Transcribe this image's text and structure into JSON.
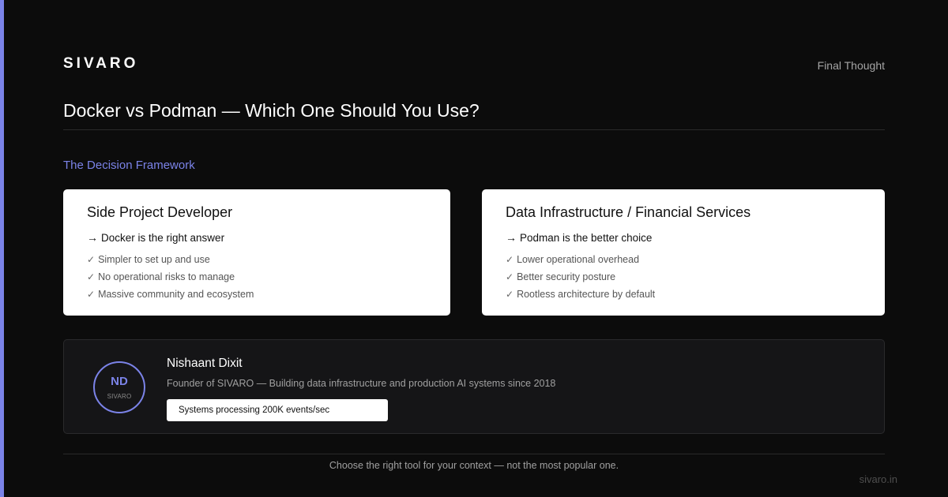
{
  "header": {
    "brand": "SIVARO",
    "tag": "Final Thought",
    "title": "Docker vs Podman — Which One Should You Use?"
  },
  "section": {
    "label": "The Decision Framework"
  },
  "cards": [
    {
      "title": "Side Project Developer",
      "verdict": "Docker is the right answer",
      "points": [
        "Simpler to set up and use",
        "No operational risks to manage",
        "Massive community and ecosystem"
      ]
    },
    {
      "title": "Data Infrastructure / Financial Services",
      "verdict": "Podman is the better choice",
      "points": [
        "Lower operational overhead",
        "Better security posture",
        "Rootless architecture by default"
      ]
    }
  ],
  "profile": {
    "initials": "ND",
    "avatar_sub": "SIVARO",
    "name": "Nishaant Dixit",
    "description": "Founder of SIVARO — Building data infrastructure and production AI systems since 2018",
    "badge": "Systems processing 200K events/sec"
  },
  "footer": {
    "quote": "Choose the right tool for your context — not the most popular one.",
    "site": "sivaro.in"
  },
  "icons": {
    "arrow": "right-arrow-icon",
    "check": "check-icon"
  },
  "colors": {
    "accent": "#7b83e8",
    "background": "#0c0c0c",
    "card": "#ffffff"
  }
}
